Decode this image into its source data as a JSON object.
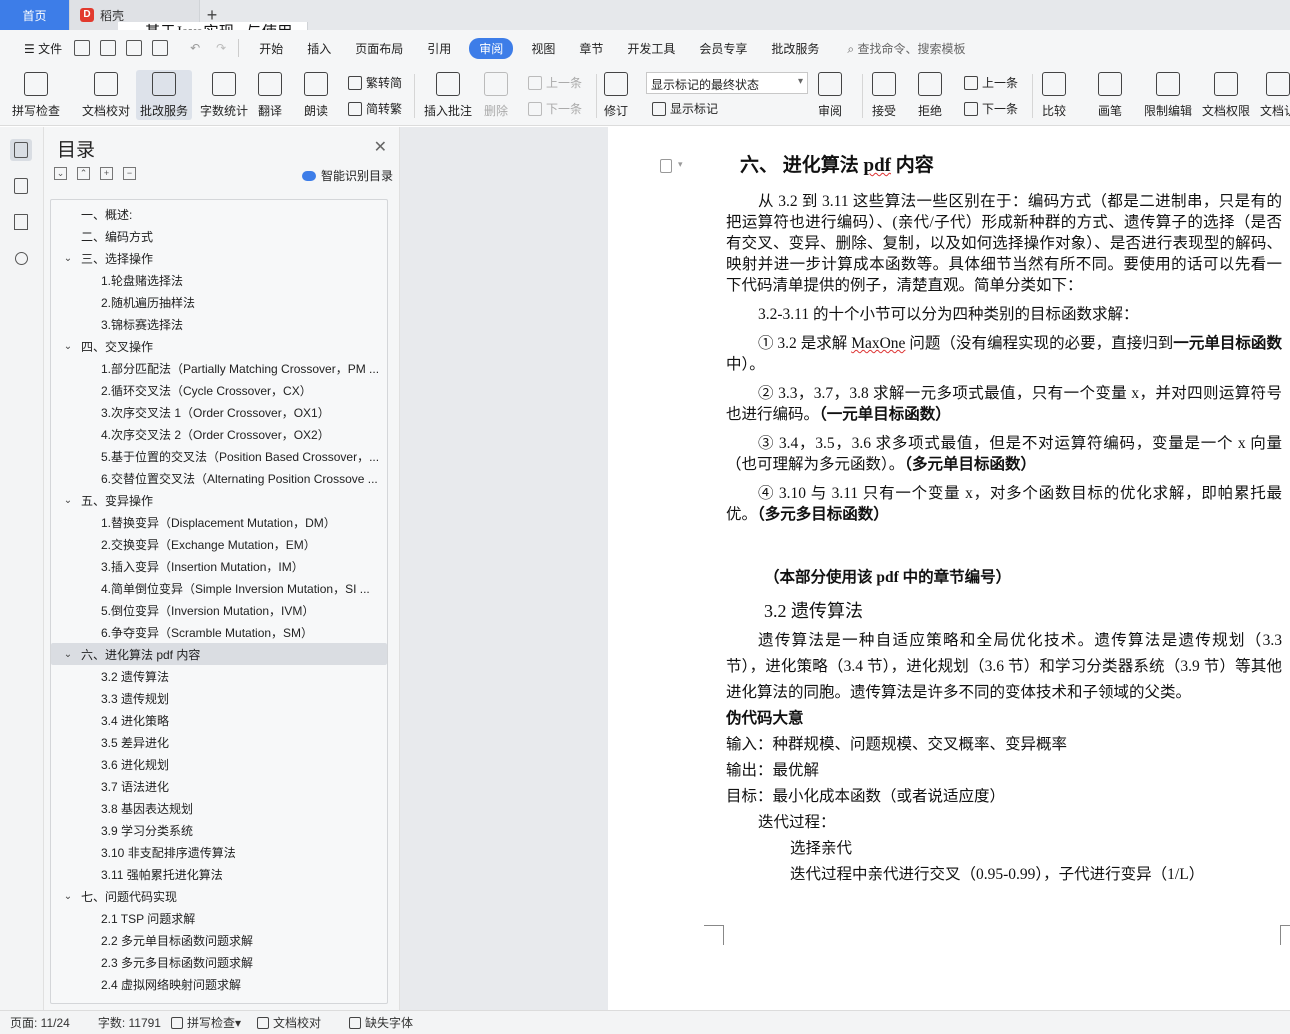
{
  "tabs": {
    "home": "首页",
    "shell": "稻壳",
    "doc": "基于Java实现...与使用 毕业论"
  },
  "menu": {
    "file": "文件",
    "items": [
      "开始",
      "插入",
      "页面布局",
      "引用",
      "审阅",
      "视图",
      "章节",
      "开发工具",
      "会员专享",
      "批改服务"
    ],
    "active": "审阅",
    "search": "查找命令、搜索模板"
  },
  "ribbon": {
    "spell": "拼写检查",
    "proof": "文档校对",
    "correct": "批改服务",
    "wordcount": "字数统计",
    "translate": "翻译",
    "read": "朗读",
    "trad": "繁转简",
    "simp": "简转繁",
    "insert_comment": "插入批注",
    "delete": "删除",
    "prev": "上一条",
    "next": "下一条",
    "revise": "修订",
    "markup_select": "显示标记的最终状态",
    "show_markup": "显示标记",
    "review": "审阅",
    "accept": "接受",
    "reject": "拒绝",
    "prev2": "上一条",
    "next2": "下一条",
    "compare": "比较",
    "pen": "画笔",
    "restrict": "限制编辑",
    "perm": "文档权限",
    "more": "文档认"
  },
  "toc": {
    "title": "目录",
    "smart": "智能识别目录",
    "items": [
      {
        "level": 1,
        "text": "一、概述:",
        "arrow": ""
      },
      {
        "level": 1,
        "text": "二、编码方式",
        "arrow": ""
      },
      {
        "level": 1,
        "text": "三、选择操作",
        "arrow": "v"
      },
      {
        "level": 2,
        "text": "1.轮盘赌选择法",
        "arrow": ""
      },
      {
        "level": 2,
        "text": "2.随机遍历抽样法",
        "arrow": ""
      },
      {
        "level": 2,
        "text": "3.锦标赛选择法",
        "arrow": ""
      },
      {
        "level": 1,
        "text": "四、交叉操作",
        "arrow": "v"
      },
      {
        "level": 2,
        "text": "1.部分匹配法（Partially Matching Crossover，PM ...",
        "arrow": ""
      },
      {
        "level": 2,
        "text": "2.循环交叉法（Cycle Crossover，CX）",
        "arrow": ""
      },
      {
        "level": 2,
        "text": "3.次序交叉法 1（Order Crossover，OX1）",
        "arrow": ""
      },
      {
        "level": 2,
        "text": "4.次序交叉法 2（Order Crossover，OX2）",
        "arrow": ""
      },
      {
        "level": 2,
        "text": "5.基于位置的交叉法（Position Based Crossover，...",
        "arrow": ""
      },
      {
        "level": 2,
        "text": "6.交替位置交叉法（Alternating Position Crossove ...",
        "arrow": ""
      },
      {
        "level": 1,
        "text": "五、变异操作",
        "arrow": "v"
      },
      {
        "level": 2,
        "text": "1.替换变异（Displacement Mutation，DM）",
        "arrow": ""
      },
      {
        "level": 2,
        "text": "2.交换变异（Exchange Mutation，EM）",
        "arrow": ""
      },
      {
        "level": 2,
        "text": "3.插入变异（Insertion Mutation，IM）",
        "arrow": ""
      },
      {
        "level": 2,
        "text": "4.简单倒位变异（Simple Inversion Mutation，SI ...",
        "arrow": ""
      },
      {
        "level": 2,
        "text": "5.倒位变异（Inversion Mutation，IVM）",
        "arrow": ""
      },
      {
        "level": 2,
        "text": "6.争夺变异（Scramble Mutation，SM）",
        "arrow": ""
      },
      {
        "level": 1,
        "text": "六、进化算法 pdf 内容",
        "arrow": "v",
        "selected": true
      },
      {
        "level": 2,
        "text": "3.2  遗传算法",
        "arrow": ""
      },
      {
        "level": 2,
        "text": "3.3  遗传规划",
        "arrow": ""
      },
      {
        "level": 2,
        "text": "3.4  进化策略",
        "arrow": ""
      },
      {
        "level": 2,
        "text": "3.5  差异进化",
        "arrow": ""
      },
      {
        "level": 2,
        "text": "3.6  进化规划",
        "arrow": ""
      },
      {
        "level": 2,
        "text": "3.7  语法进化",
        "arrow": ""
      },
      {
        "level": 2,
        "text": "3.8  基因表达规划",
        "arrow": ""
      },
      {
        "level": 2,
        "text": "3.9  学习分类系统",
        "arrow": ""
      },
      {
        "level": 2,
        "text": "3.10  非支配排序遗传算法",
        "arrow": ""
      },
      {
        "level": 2,
        "text": "3.11  强帕累托进化算法",
        "arrow": ""
      },
      {
        "level": 1,
        "text": "七、问题代码实现",
        "arrow": "v"
      },
      {
        "level": 2,
        "text": "2.1 TSP 问题求解",
        "arrow": ""
      },
      {
        "level": 2,
        "text": "2.2  多元单目标函数问题求解",
        "arrow": ""
      },
      {
        "level": 2,
        "text": "2.3  多元多目标函数问题求解",
        "arrow": ""
      },
      {
        "level": 2,
        "text": "2.4  虚拟网络映射问题求解",
        "arrow": ""
      }
    ]
  },
  "document": {
    "heading": "六、 进化算法 pdf 内容",
    "p1": "从 3.2 到 3.11 这些算法一些区别在于：编码方式（都是二进制串，只是有的把运算符也进行编码）、(亲代/子代）形成新种群的方式、遗传算子的选择（是否有交叉、变异、删除、复制，以及如何选择操作对象）、是否进行表现型的解码、映射并进一步计算成本函数等。具体细节当然有所不同。要使用的话可以先看一下代码清单提供的例子，清楚直观。简单分类如下：",
    "p2": "3.2-3.11 的十个小节可以分为四种类别的目标函数求解：",
    "p3a": "① 3.2 是求解 ",
    "p3b": "MaxOne",
    "p3c": " 问题（没有编程实现的必要，直接归到",
    "p3d": "一元单目标函数",
    "p3e": "中）。",
    "p4a": "② 3.3，3.7，3.8 求解一元多项式最值，只有一个变量 x，并对四则运算符号也进行编码。",
    "p4b": "（一元单目标函数）",
    "p5a": "③ 3.4，3.5，3.6 求多项式最值，但是不对运算符编码，变量是一个 x 向量（也可理解为多元函数）。",
    "p5b": "（多元单目标函数）",
    "p6a": "④ 3.10 与 3.11 只有一个变量 x，对多个函数目标的优化求解，即帕累托最优。",
    "p6b": "（多元多目标函数）",
    "note": "（本部分使用该 pdf 中的章节编号）",
    "h2": "3.2  遗传算法",
    "p7": "遗传算法是一种自适应策略和全局优化技术。遗传算法是遗传规划（3.3 节），进化策略（3.4 节），进化规划（3.6 节）和学习分类器系统（3.9 节）等其他进化算法的同胞。遗传算法是许多不同的变体技术和子领域的父类。",
    "pseudo": "伪代码大意",
    "input": "输入：种群规模、问题规模、交叉概率、变异概率",
    "output": "输出：最优解",
    "goal": "目标：最小化成本函数（或者说适应度）",
    "iter": "迭代过程：",
    "sel": "选择亲代",
    "cross": "迭代过程中亲代进行交叉（0.95-0.99），子代进行变异（1/L）"
  },
  "status": {
    "page": "页面: 11/24",
    "words": "字数: 11791",
    "spell": "拼写检查",
    "proof": "文档校对",
    "font": "缺失字体"
  }
}
